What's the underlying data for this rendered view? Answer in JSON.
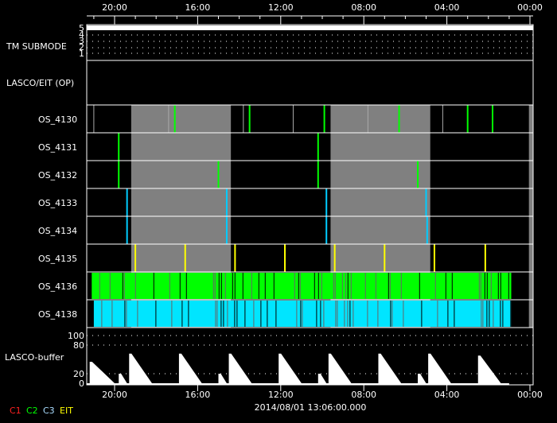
{
  "chart_data": {
    "type": "timeline",
    "xaxis": {
      "ticks": [
        "20:00",
        "16:00",
        "12:00",
        "08:00",
        "04:00",
        "00:00"
      ],
      "tick_hours_before_end": [
        20,
        16,
        12,
        8,
        4,
        0
      ],
      "range_hours_before_end": [
        21.3,
        -0.15
      ],
      "date_label": "2014/08/01 13:06:00.000"
    },
    "tm_submode": {
      "label": "TM SUBMODE",
      "ticks": [
        "5",
        "4",
        "3",
        "2",
        "1"
      ],
      "value": 5
    },
    "lasco_eit": {
      "label": "LASCO/EIT (OP)"
    },
    "gray_intervals_hours": [
      [
        19.2,
        14.4
      ],
      [
        9.6,
        4.8
      ],
      [
        0.05,
        -0.15
      ]
    ],
    "rows": [
      {
        "label": "OS_4130",
        "color": "#00ff00",
        "events": [
          17.1,
          13.5,
          9.9,
          6.3,
          3.0,
          1.8
        ],
        "white_events": [
          21.0,
          17.4,
          13.8,
          11.4,
          7.8,
          4.2
        ]
      },
      {
        "label": "OS_4131",
        "color": "#00ff00",
        "events": [
          19.8,
          10.2
        ]
      },
      {
        "label": "OS_4132",
        "color": "#00ff00",
        "events": [
          19.8,
          15.0,
          10.2,
          5.4
        ]
      },
      {
        "label": "OS_4133",
        "color": "#00ccff",
        "events": [
          19.4,
          14.6,
          9.8,
          5.0
        ]
      },
      {
        "label": "OS_4134",
        "color": "#00ccff",
        "events": [
          19.4,
          14.6,
          9.8,
          4.95
        ]
      },
      {
        "label": "OS_4135",
        "color": "#ffff00",
        "events": [
          19.0,
          16.6,
          14.2,
          11.8,
          9.4,
          7.0,
          4.6,
          2.15
        ]
      },
      {
        "label": "OS_4136",
        "color": "#00ff00",
        "dense": [
          21.1,
          0.9
        ]
      },
      {
        "label": "OS_4138",
        "color": "#00e5ff",
        "dense": [
          21.0,
          0.9
        ]
      }
    ],
    "buffer": {
      "label": "LASCO-buffer",
      "ticks": [
        "100",
        "80",
        "20",
        "0"
      ],
      "ylim": [
        0,
        100
      ],
      "peaks": [
        [
          21.2,
          45,
          1.2
        ],
        [
          19.8,
          20,
          0.4
        ],
        [
          19.3,
          62,
          1.1
        ],
        [
          16.9,
          62,
          1.1
        ],
        [
          15.0,
          20,
          0.4
        ],
        [
          14.5,
          62,
          1.1
        ],
        [
          12.1,
          62,
          1.1
        ],
        [
          10.2,
          20,
          0.4
        ],
        [
          9.7,
          62,
          1.1
        ],
        [
          7.3,
          62,
          1.1
        ],
        [
          5.4,
          20,
          0.4
        ],
        [
          4.9,
          62,
          1.1
        ],
        [
          2.5,
          58,
          1.1
        ]
      ]
    },
    "legend": [
      {
        "label": "C1",
        "color": "#ff2020"
      },
      {
        "label": "C2",
        "color": "#00ff00"
      },
      {
        "label": "C3",
        "color": "#aaddff"
      },
      {
        "label": "EIT",
        "color": "#ffff00"
      }
    ]
  }
}
